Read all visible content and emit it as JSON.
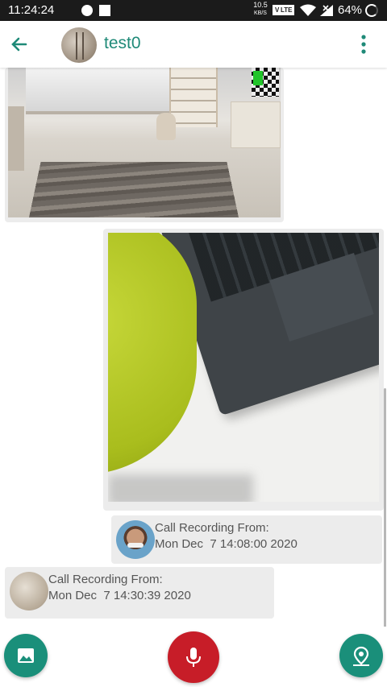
{
  "status_bar": {
    "time": "11:24:24",
    "net_speed_value": "10.5",
    "net_speed_unit": "KB/S",
    "volte": "V LTE",
    "battery_percent": "64%"
  },
  "header": {
    "contact_name": "test0",
    "back_icon": "arrow-left-icon",
    "menu_icon": "more-vertical-icon"
  },
  "colors": {
    "accent": "#1f8a78",
    "fab_green": "#1a8f7a",
    "mic_red": "#c71d28",
    "bubble_bg": "#ececec"
  },
  "messages": [
    {
      "type": "image",
      "direction": "incoming",
      "content": "room-photo"
    },
    {
      "type": "image",
      "direction": "outgoing",
      "content": "laptop-photo"
    },
    {
      "type": "call-recording",
      "direction": "outgoing",
      "line1": "Call Recording From:",
      "line2": "Mon Dec  7 14:08:00 2020"
    },
    {
      "type": "call-recording",
      "direction": "incoming",
      "line1": "Call Recording From:",
      "line2": "Mon Dec  7 14:30:39 2020"
    }
  ],
  "bottom_actions": [
    {
      "icon": "image-gallery-icon"
    },
    {
      "icon": "microphone-icon"
    },
    {
      "icon": "location-pin-icon"
    }
  ]
}
